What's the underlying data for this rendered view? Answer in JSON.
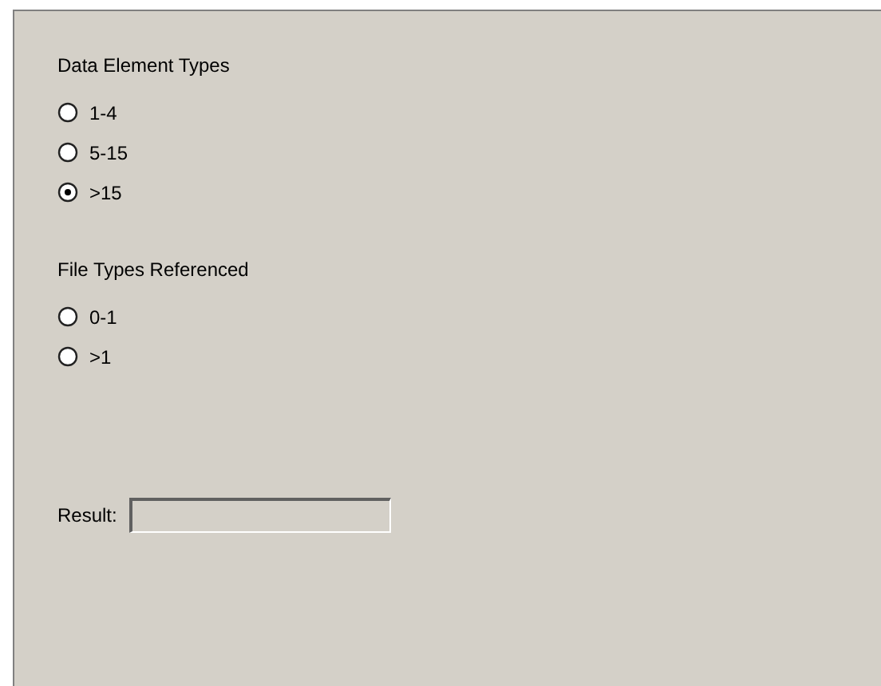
{
  "groups": [
    {
      "heading": "Data Element Types",
      "options": [
        {
          "label": "1-4",
          "selected": false
        },
        {
          "label": "5-15",
          "selected": false
        },
        {
          "label": ">15",
          "selected": true
        }
      ]
    },
    {
      "heading": "File Types Referenced",
      "options": [
        {
          "label": "0-1",
          "selected": false
        },
        {
          "label": ">1",
          "selected": false
        }
      ]
    }
  ],
  "result": {
    "label": "Result:"
  }
}
